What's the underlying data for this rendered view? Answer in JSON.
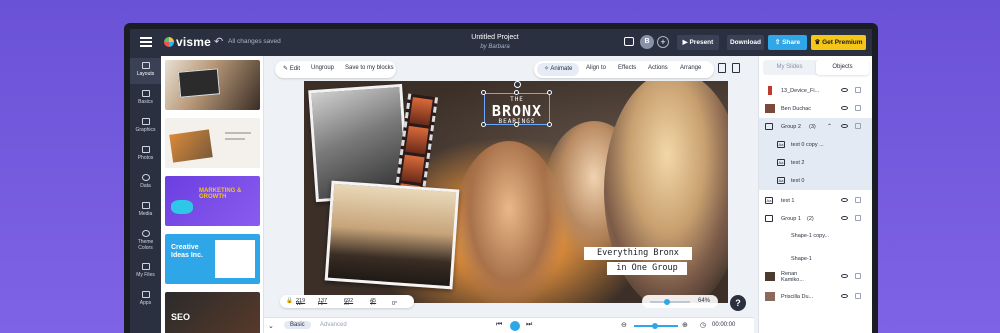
{
  "app": {
    "name": "visme",
    "save_status": "All changes saved",
    "project_title": "Untitled Project",
    "project_author": "by Barbara",
    "avatar_initial": "B"
  },
  "topbar": {
    "present_label": "Present",
    "download_label": "Download",
    "share_label": "Share",
    "premium_label": "Get Premium"
  },
  "rail": {
    "items": [
      {
        "label": "Layouts",
        "icon": "layouts-icon"
      },
      {
        "label": "Basics",
        "icon": "basics-icon"
      },
      {
        "label": "Graphics",
        "icon": "graphics-icon"
      },
      {
        "label": "Photos",
        "icon": "photos-icon"
      },
      {
        "label": "Data",
        "icon": "data-icon"
      },
      {
        "label": "Media",
        "icon": "media-icon"
      },
      {
        "label": "Theme Colors",
        "icon": "palette-icon"
      },
      {
        "label": "My Files",
        "icon": "folder-icon"
      },
      {
        "label": "Apps",
        "icon": "apps-icon"
      }
    ]
  },
  "thumbnails": [
    {
      "text": ""
    },
    {
      "text": ""
    },
    {
      "text": "MARKETING & GROWTH"
    },
    {
      "text": "Creative Ideas Inc."
    },
    {
      "text": "SEO"
    }
  ],
  "toolbar": {
    "edit_label": "Edit",
    "ungroup_label": "Ungroup",
    "save_blocks_label": "Save to my blocks",
    "animate_label": "Animate",
    "align_label": "Align to",
    "effects_label": "Effects",
    "actions_label": "Actions",
    "arrange_label": "Arrange"
  },
  "canvas": {
    "title_small_top": "THE",
    "title_big": "BRONX",
    "title_small_bottom": "BEARINGS",
    "label_line1": "Everything Bronx",
    "label_line2": "in One Group"
  },
  "dims": {
    "w_label": "W:",
    "w_value": "219",
    "h_label": "H:",
    "h_value": "137",
    "x_label": "X:",
    "x_value": "692",
    "y_label": "Y:",
    "y_value": "45",
    "rotation_value": "0°"
  },
  "zoom": {
    "value": "64%"
  },
  "help_label": "?",
  "timeline": {
    "basic_label": "Basic",
    "advanced_label": "Advanced",
    "time": "00:00:00"
  },
  "rpanel": {
    "tab_slides": "My Slides",
    "tab_objects": "Objects",
    "layers": [
      {
        "name": "13_Device_Fi...",
        "type": "image",
        "selected": false
      },
      {
        "name": "Ben Duchac",
        "type": "image",
        "selected": false
      },
      {
        "name": "Group 2",
        "count": "(3)",
        "type": "group",
        "selected": true
      },
      {
        "name": "text 0 copy ...",
        "type": "text",
        "selected": true,
        "indent": true
      },
      {
        "name": "text 2",
        "type": "text",
        "selected": true,
        "indent": true
      },
      {
        "name": "text 0",
        "type": "text",
        "selected": true,
        "indent": true
      },
      {
        "name": "text 1",
        "type": "text",
        "selected": false
      },
      {
        "name": "Group 1",
        "count": "(2)",
        "type": "group",
        "selected": false
      },
      {
        "name": "Shape-1 copy...",
        "type": "shape",
        "selected": false,
        "indent": true
      },
      {
        "name": "Shape-1",
        "type": "shape",
        "selected": false,
        "indent": true
      },
      {
        "name": "Renan Kamiko...",
        "type": "image",
        "selected": false
      },
      {
        "name": "Priscilla Du...",
        "type": "image",
        "selected": false
      }
    ]
  },
  "colors": {
    "background": "#7f63e6",
    "topbar": "#2b3040",
    "accent": "#2fa6e8",
    "premium": "#f5c518"
  }
}
